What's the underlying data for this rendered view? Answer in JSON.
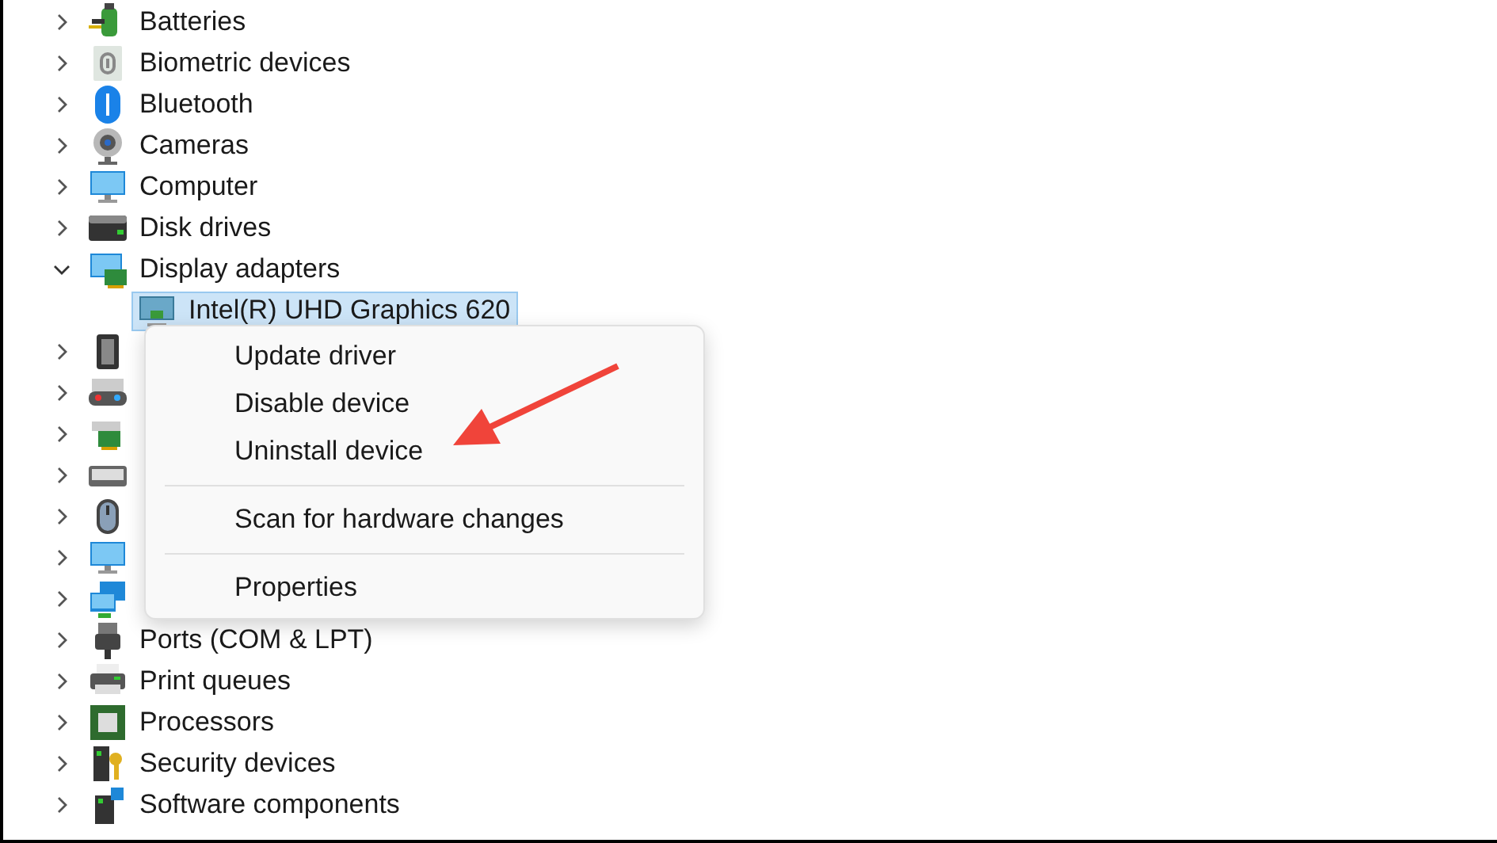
{
  "tree": [
    {
      "label": "Batteries",
      "expanded": false
    },
    {
      "label": "Biometric devices",
      "expanded": false
    },
    {
      "label": "Bluetooth",
      "expanded": false
    },
    {
      "label": "Cameras",
      "expanded": false
    },
    {
      "label": "Computer",
      "expanded": false
    },
    {
      "label": "Disk drives",
      "expanded": false
    },
    {
      "label": "Display adapters",
      "expanded": true,
      "children": [
        {
          "label": "Intel(R) UHD Graphics 620",
          "selected": true
        }
      ]
    },
    {
      "expanded": false
    },
    {
      "expanded": false
    },
    {
      "expanded": false
    },
    {
      "expanded": false
    },
    {
      "expanded": false
    },
    {
      "expanded": false
    },
    {
      "expanded": false
    },
    {
      "label": "Ports (COM & LPT)",
      "expanded": false
    },
    {
      "label": "Print queues",
      "expanded": false
    },
    {
      "label": "Processors",
      "expanded": false
    },
    {
      "label": "Security devices",
      "expanded": false
    },
    {
      "label": "Software components",
      "expanded": false
    }
  ],
  "context_menu": [
    {
      "kind": "item",
      "label": "Update driver"
    },
    {
      "kind": "item",
      "label": "Disable device"
    },
    {
      "kind": "item",
      "label": "Uninstall device"
    },
    {
      "kind": "separator"
    },
    {
      "kind": "item",
      "label": "Scan for hardware changes"
    },
    {
      "kind": "separator"
    },
    {
      "kind": "item",
      "label": "Properties"
    }
  ]
}
